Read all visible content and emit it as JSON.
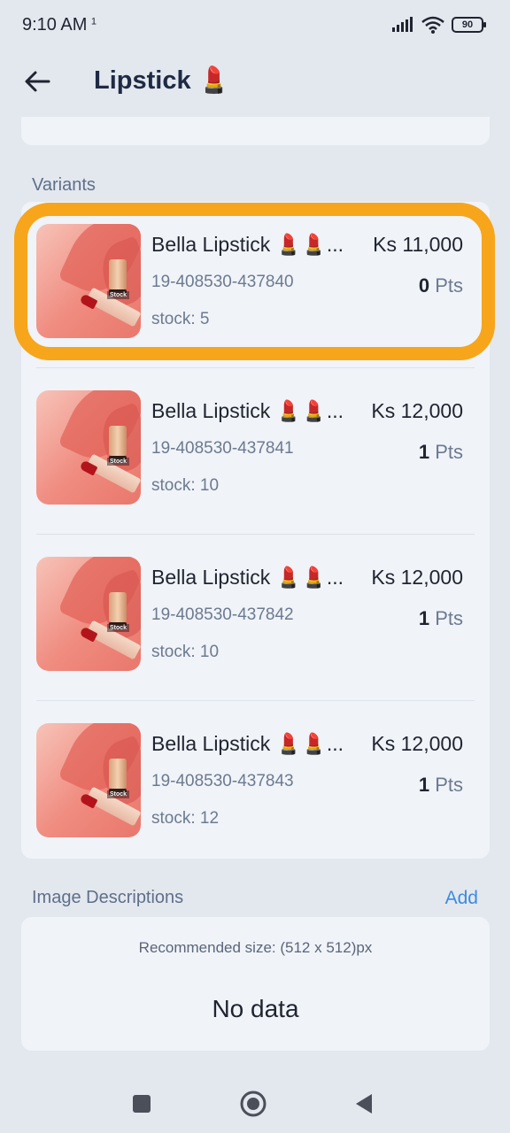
{
  "status": {
    "time": "9:10 AM",
    "time_suffix": "1",
    "battery": "90"
  },
  "header": {
    "title": "Lipstick",
    "title_emoji": "💄"
  },
  "sections": {
    "variants_label": "Variants",
    "images_label": "Image Descriptions",
    "images_add": "Add"
  },
  "variants": [
    {
      "name": "Bella Lipstick 💄💄...",
      "price": "Ks 11,000",
      "sku": "19-408530-437840",
      "points": "0",
      "points_unit": "Pts",
      "stock": "stock: 5"
    },
    {
      "name": "Bella Lipstick 💄💄...",
      "price": "Ks 12,000",
      "sku": "19-408530-437841",
      "points": "1",
      "points_unit": "Pts",
      "stock": "stock: 10"
    },
    {
      "name": "Bella Lipstick 💄💄...",
      "price": "Ks 12,000",
      "sku": "19-408530-437842",
      "points": "1",
      "points_unit": "Pts",
      "stock": "stock: 10"
    },
    {
      "name": "Bella Lipstick 💄💄...",
      "price": "Ks 12,000",
      "sku": "19-408530-437843",
      "points": "1",
      "points_unit": "Pts",
      "stock": "stock: 12"
    }
  ],
  "thumbnail_stamp": "Stock",
  "images": {
    "recommended": "Recommended size: (512 x 512)px",
    "empty": "No data"
  },
  "colors": {
    "highlight": "#f7a51b",
    "link": "#3b8be0"
  }
}
